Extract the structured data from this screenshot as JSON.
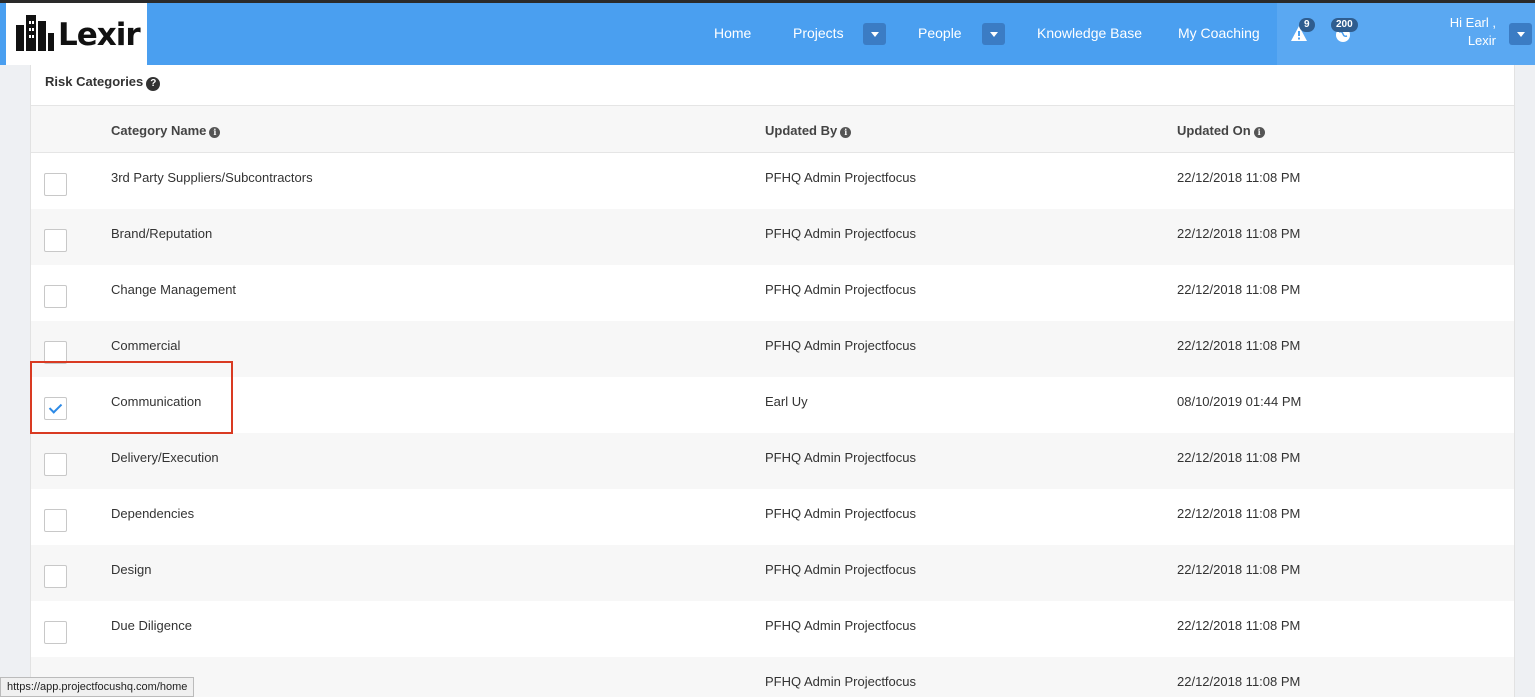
{
  "brand": {
    "logo_text": "Lexir"
  },
  "nav": {
    "home": "Home",
    "projects": "Projects",
    "people": "People",
    "knowledge_base": "Knowledge Base",
    "my_coaching": "My Coaching",
    "alerts_count": "9",
    "notifications_count": "200",
    "greeting_line1": "Hi Earl ,",
    "greeting_line2": "Lexir"
  },
  "panel": {
    "title": "Risk Categories",
    "columns": {
      "name": "Category Name",
      "updated_by": "Updated By",
      "updated_on": "Updated On"
    },
    "rows": [
      {
        "name": "3rd Party Suppliers/Subcontractors",
        "updated_by": "PFHQ Admin Projectfocus",
        "updated_on": "22/12/2018 11:08 PM",
        "checked": false
      },
      {
        "name": "Brand/Reputation",
        "updated_by": "PFHQ Admin Projectfocus",
        "updated_on": "22/12/2018 11:08 PM",
        "checked": false
      },
      {
        "name": "Change Management",
        "updated_by": "PFHQ Admin Projectfocus",
        "updated_on": "22/12/2018 11:08 PM",
        "checked": false
      },
      {
        "name": "Commercial",
        "updated_by": "PFHQ Admin Projectfocus",
        "updated_on": "22/12/2018 11:08 PM",
        "checked": false
      },
      {
        "name": "Communication",
        "updated_by": "Earl Uy",
        "updated_on": "08/10/2019 01:44 PM",
        "checked": true
      },
      {
        "name": "Delivery/Execution",
        "updated_by": "PFHQ Admin Projectfocus",
        "updated_on": "22/12/2018 11:08 PM",
        "checked": false
      },
      {
        "name": "Dependencies",
        "updated_by": "PFHQ Admin Projectfocus",
        "updated_on": "22/12/2018 11:08 PM",
        "checked": false
      },
      {
        "name": "Design",
        "updated_by": "PFHQ Admin Projectfocus",
        "updated_on": "22/12/2018 11:08 PM",
        "checked": false
      },
      {
        "name": "Due Diligence",
        "updated_by": "PFHQ Admin Projectfocus",
        "updated_on": "22/12/2018 11:08 PM",
        "checked": false
      },
      {
        "name": "",
        "updated_by": "PFHQ Admin Projectfocus",
        "updated_on": "22/12/2018 11:08 PM",
        "checked": false
      }
    ]
  },
  "statusbar": {
    "url": "https://app.projectfocushq.com/home"
  },
  "colors": {
    "topbar": "#4a9ff0",
    "highlight": "#d93a22",
    "check": "#2d8ae6"
  }
}
